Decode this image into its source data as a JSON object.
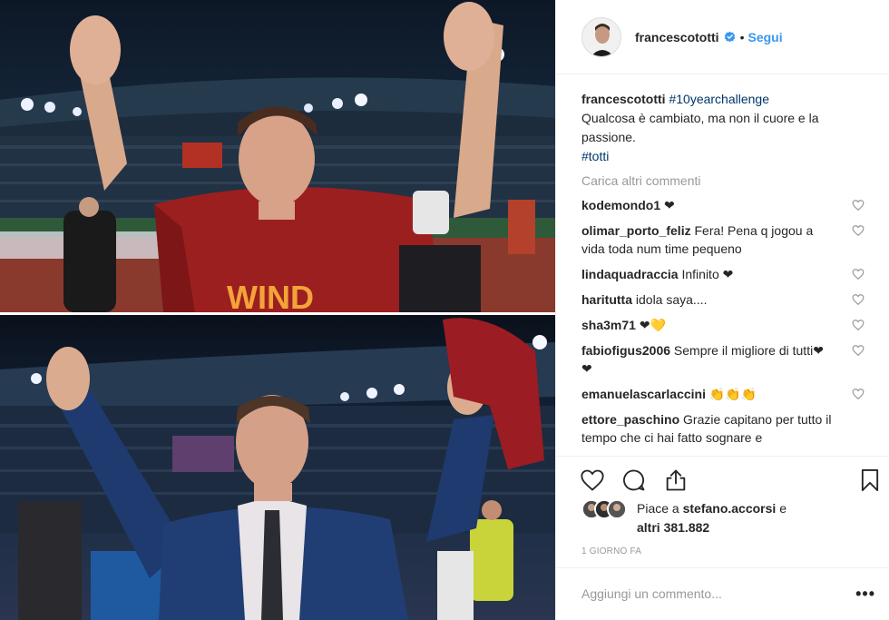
{
  "header": {
    "username": "francescototti",
    "follow_label": "Segui",
    "dot": "•"
  },
  "caption": {
    "username": "francescototti",
    "hashtag1": "#10yearchallenge",
    "text": "Qualcosa è cambiato, ma non il cuore e la passione.",
    "hashtag2": "#totti"
  },
  "load_more_label": "Carica altri commenti",
  "comments": [
    {
      "user": "kodemondo1",
      "text": "❤"
    },
    {
      "user": "olimar_porto_feliz",
      "text": "Fera! Pena q jogou a vida toda num time pequeno"
    },
    {
      "user": "lindaquadraccia",
      "text": "Infinito ❤"
    },
    {
      "user": "haritutta",
      "text": "idola saya...."
    },
    {
      "user": "sha3m71",
      "text": "❤💛"
    },
    {
      "user": "fabiofigus2006",
      "text": "Sempre il migliore di tutti❤❤"
    },
    {
      "user": "emanuelascarlaccini",
      "text": "👏👏👏"
    },
    {
      "user": "ettore_paschino",
      "text": "Grazie capitano per tutto il tempo che ci hai fatto sognare e"
    }
  ],
  "likes": {
    "prefix": "Piace a",
    "liker": "stefano.accorsi",
    "connector": "e",
    "others": "altri 381.882"
  },
  "timestamp": "1 GIORNO FA",
  "add_comment": {
    "placeholder": "Aggiungi un commento..."
  },
  "more_label": "•••",
  "icons": {
    "verified": "verified-badge-icon",
    "like": "heart-icon",
    "comment": "comment-bubble-icon",
    "share": "share-icon",
    "save": "bookmark-icon",
    "more": "more-options-icon"
  },
  "colors": {
    "link_blue": "#3897f0",
    "hashtag": "#003569",
    "muted": "#999999",
    "text": "#262626",
    "border": "#efefef"
  }
}
